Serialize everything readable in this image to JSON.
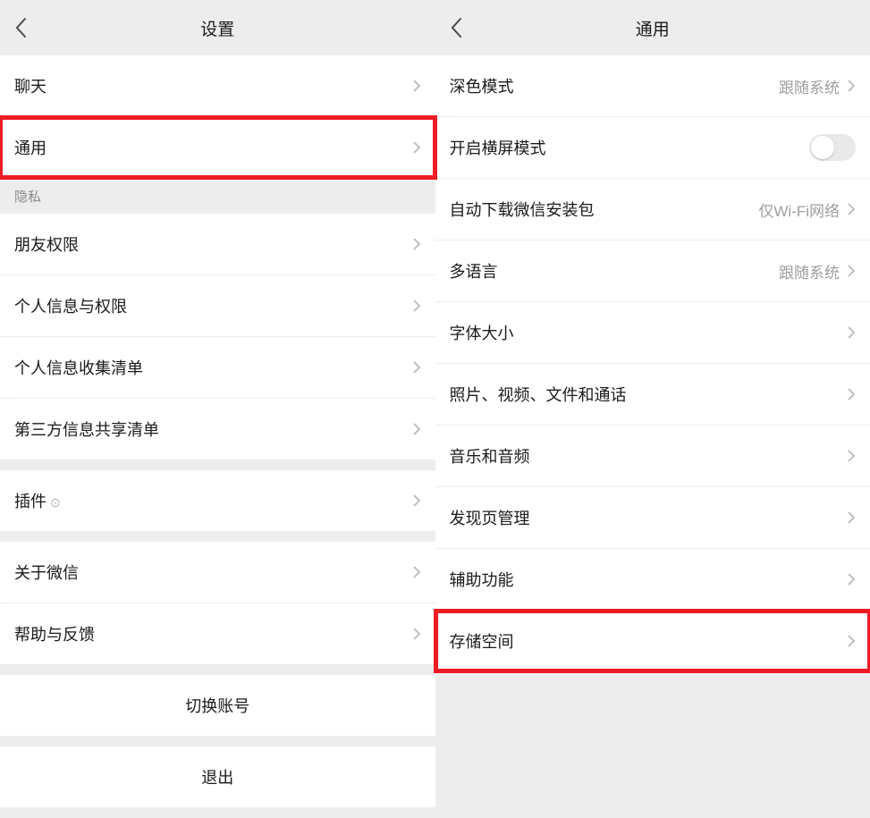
{
  "left_panel": {
    "title": "设置",
    "items": {
      "chat": "聊天",
      "general": "通用",
      "privacy_header": "隐私",
      "friends_permission": "朋友权限",
      "personal_info": "个人信息与权限",
      "personal_info_collection": "个人信息收集清单",
      "third_party_sharing": "第三方信息共享清单",
      "plugins": "插件",
      "about": "关于微信",
      "help_feedback": "帮助与反馈",
      "switch_account": "切换账号",
      "logout": "退出"
    }
  },
  "right_panel": {
    "title": "通用",
    "items": {
      "dark_mode": {
        "label": "深色模式",
        "value": "跟随系统"
      },
      "landscape": {
        "label": "开启横屏模式"
      },
      "auto_download": {
        "label": "自动下载微信安装包",
        "value": "仅Wi-Fi网络"
      },
      "multi_language": {
        "label": "多语言",
        "value": "跟随系统"
      },
      "font_size": {
        "label": "字体大小"
      },
      "media_files": {
        "label": "照片、视频、文件和通话"
      },
      "music_audio": {
        "label": "音乐和音频"
      },
      "discover_manage": {
        "label": "发现页管理"
      },
      "accessibility": {
        "label": "辅助功能"
      },
      "storage": {
        "label": "存储空间"
      }
    }
  }
}
